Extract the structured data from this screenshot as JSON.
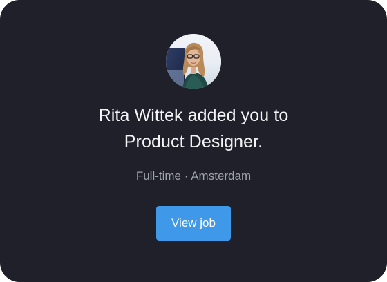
{
  "notification": {
    "avatar_icon": "user-photo-avatar",
    "line1": "Rita Wittek added you to",
    "line2": "Product Designer.",
    "employment_type": "Full-time",
    "separator": "·",
    "location": "Amsterdam",
    "button_label": "View job"
  },
  "colors": {
    "card_background": "#1f2029",
    "button_background": "#3f98e8",
    "meta_text": "#9fa3ad"
  }
}
